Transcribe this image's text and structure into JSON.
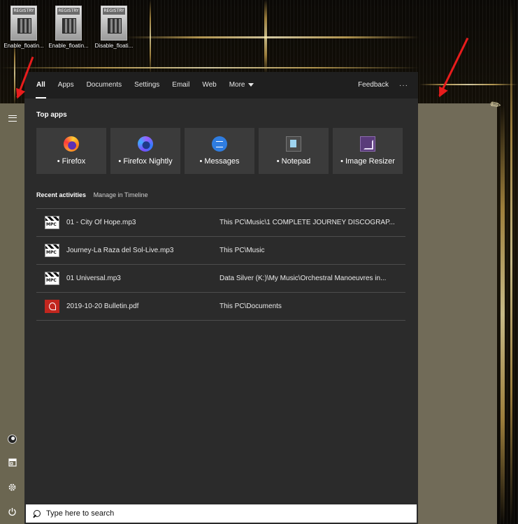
{
  "desktop": {
    "icons": [
      {
        "label": "Enable_floatin...",
        "badge": "REGISTRY"
      },
      {
        "label": "Enable_floatin...",
        "badge": "REGISTRY"
      },
      {
        "label": "Disable_floati...",
        "badge": "REGISTRY"
      }
    ]
  },
  "tabs": {
    "all": "All",
    "apps": "Apps",
    "documents": "Documents",
    "settings": "Settings",
    "email": "Email",
    "web": "Web",
    "more": "More",
    "feedback": "Feedback",
    "ellipsis": "···"
  },
  "top_apps": {
    "title": "Top apps",
    "items": [
      {
        "label": "Firefox",
        "icon": "firefox-icon"
      },
      {
        "label": "Firefox Nightly",
        "icon": "firefox-nightly-icon"
      },
      {
        "label": "Messages",
        "icon": "messages-icon"
      },
      {
        "label": "Notepad",
        "icon": "notepad-icon"
      },
      {
        "label": "Image Resizer",
        "icon": "image-resizer-icon"
      }
    ],
    "bullet": "•"
  },
  "recent": {
    "title": "Recent activities",
    "manage": "Manage in Timeline",
    "items": [
      {
        "name": "01 - City Of Hope.mp3",
        "path": "This PC\\Music\\1 COMPLETE JOURNEY DISCOGRAP...",
        "icon": "mpc-file-icon"
      },
      {
        "name": "Journey-La Raza del Sol-Live.mp3",
        "path": "This PC\\Music",
        "icon": "mpc-file-icon"
      },
      {
        "name": "01 Universal.mp3",
        "path": "Data Silver (K:)\\My Music\\Orchestral Manoeuvres in...",
        "icon": "mpc-file-icon"
      },
      {
        "name": "2019-10-20 Bulletin.pdf",
        "path": "This PC\\Documents",
        "icon": "pdf-file-icon"
      }
    ]
  },
  "search": {
    "placeholder": "Type here to search"
  },
  "colors": {
    "flyout_bg": "#2b2b2b",
    "tabbar_bg": "#1f1f1f",
    "tile_bg": "#3b3b3b",
    "taupe": "#716b58",
    "arrow": "#e81c1c"
  }
}
